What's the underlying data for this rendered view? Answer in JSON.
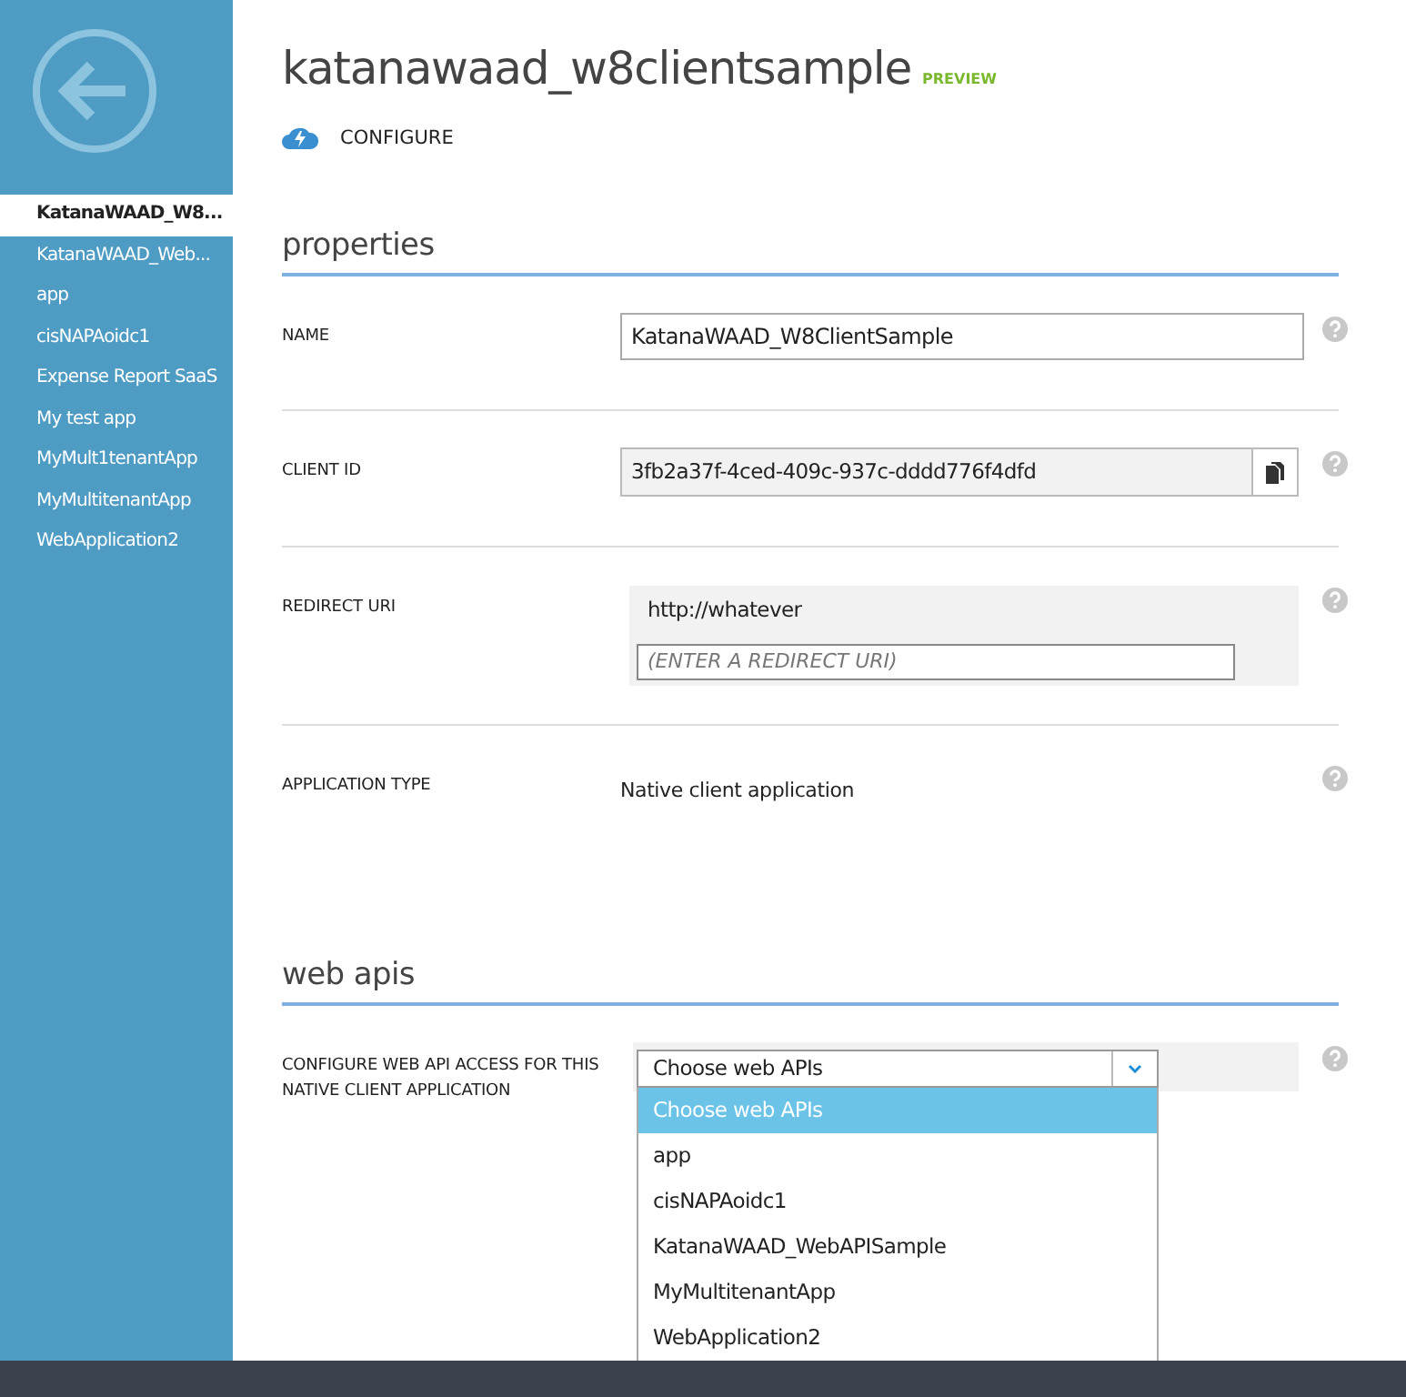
{
  "sidebar": {
    "items": [
      {
        "label": "KatanaWAAD_W8...",
        "selected": true
      },
      {
        "label": "KatanaWAAD_Web...",
        "selected": false
      },
      {
        "label": "app",
        "selected": false
      },
      {
        "label": "cisNAPAoidc1",
        "selected": false
      },
      {
        "label": "Expense Report SaaS",
        "selected": false
      },
      {
        "label": "My test app",
        "selected": false
      },
      {
        "label": "MyMult1tenantApp",
        "selected": false
      },
      {
        "label": "MyMultitenantApp",
        "selected": false
      },
      {
        "label": "WebApplication2",
        "selected": false
      }
    ]
  },
  "header": {
    "title": "katanawaad_w8clientsample",
    "badge": "PREVIEW",
    "tab": "CONFIGURE"
  },
  "sections": [
    {
      "heading": "properties",
      "rows": [
        {
          "kind": "text-field",
          "label": "NAME",
          "value": "KatanaWAAD_W8ClientSample"
        },
        {
          "kind": "copy-field",
          "label": "CLIENT ID",
          "value": "3fb2a37f-4ced-409c-937c-dddd776f4dfd"
        },
        {
          "kind": "uri-list",
          "label": "REDIRECT URI",
          "values": [
            "http://whatever"
          ],
          "placeholder": "(ENTER A REDIRECT URI)"
        },
        {
          "kind": "static",
          "label": "APPLICATION TYPE",
          "value": "Native client application"
        }
      ]
    },
    {
      "heading": "web apis",
      "rows": [
        {
          "kind": "dropdown",
          "label": "CONFIGURE WEB API ACCESS FOR THIS NATIVE CLIENT APPLICATION",
          "value": "Choose web APIs",
          "expanded": true,
          "options": [
            {
              "label": "Choose web APIs",
              "selected": true
            },
            {
              "label": "app",
              "selected": false
            },
            {
              "label": "cisNAPAoidc1",
              "selected": false
            },
            {
              "label": "KatanaWAAD_WebAPISample",
              "selected": false
            },
            {
              "label": "MyMultitenantApp",
              "selected": false
            },
            {
              "label": "WebApplication2",
              "selected": false
            }
          ]
        }
      ]
    }
  ]
}
